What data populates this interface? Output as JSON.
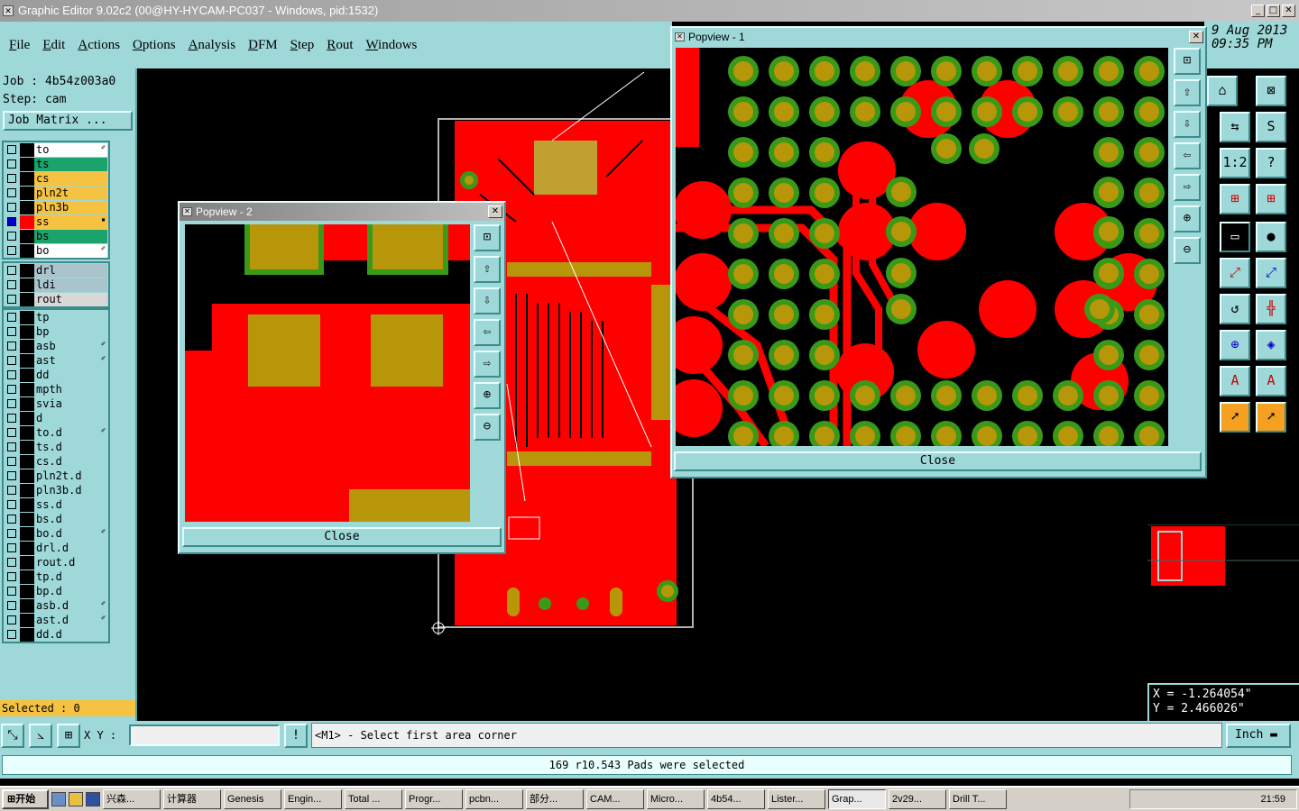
{
  "window": {
    "title": "Graphic Editor 9.02c2 (00@HY-HYCAM-PC037 - Windows, pid:1532)"
  },
  "menu": [
    "File",
    "Edit",
    "Actions",
    "Options",
    "Analysis",
    "DFM",
    "Step",
    "Rout",
    "Windows"
  ],
  "datetime": {
    "date": "9 Aug 2013",
    "time": "09:35 PM"
  },
  "job": {
    "job_line": "Job : 4b54z003a0",
    "step_line": "Step: cam",
    "matrix_button": "Job Matrix ..."
  },
  "layers_board": [
    {
      "name": "to",
      "color": "#ffffff",
      "mark": "✐"
    },
    {
      "name": "ts",
      "color": "#1aa36b",
      "mark": ""
    },
    {
      "name": "cs",
      "color": "#f5c242",
      "mark": ""
    },
    {
      "name": "pln2t",
      "color": "#f5c242",
      "mark": ""
    },
    {
      "name": "pln3b",
      "color": "#f5c242",
      "mark": ""
    },
    {
      "name": "ss",
      "color": "#f5c242",
      "mark": "▪"
    },
    {
      "name": "bs",
      "color": "#1aa36b",
      "mark": ""
    },
    {
      "name": "bo",
      "color": "#ffffff",
      "mark": "✐"
    }
  ],
  "layers_drill": [
    {
      "name": "drl",
      "color": "#a9c4cc",
      "mark": ""
    },
    {
      "name": "ldi",
      "color": "#a9c4cc",
      "mark": ""
    },
    {
      "name": "rout",
      "color": "#d8d8d8",
      "mark": ""
    }
  ],
  "layers_misc": [
    {
      "name": "tp",
      "mark": ""
    },
    {
      "name": "bp",
      "mark": ""
    },
    {
      "name": "asb",
      "mark": "✐"
    },
    {
      "name": "ast",
      "mark": "✐"
    },
    {
      "name": "dd",
      "mark": ""
    },
    {
      "name": "mpth",
      "mark": ""
    },
    {
      "name": "svia",
      "mark": ""
    },
    {
      "name": "d",
      "mark": ""
    },
    {
      "name": "to.d",
      "mark": "✐"
    },
    {
      "name": "ts.d",
      "mark": ""
    },
    {
      "name": "cs.d",
      "mark": ""
    },
    {
      "name": "pln2t.d",
      "mark": ""
    },
    {
      "name": "pln3b.d",
      "mark": ""
    },
    {
      "name": "ss.d",
      "mark": ""
    },
    {
      "name": "bs.d",
      "mark": ""
    },
    {
      "name": "bo.d",
      "mark": "✐"
    },
    {
      "name": "drl.d",
      "mark": ""
    },
    {
      "name": "rout.d",
      "mark": ""
    },
    {
      "name": "tp.d",
      "mark": ""
    },
    {
      "name": "bp.d",
      "mark": ""
    },
    {
      "name": "asb.d",
      "mark": "✐"
    },
    {
      "name": "ast.d",
      "mark": "✐"
    },
    {
      "name": "dd.d",
      "mark": ""
    }
  ],
  "selected": "Selected : 0",
  "popview1": {
    "title": "Popview - 1",
    "close": "Close"
  },
  "popview2": {
    "title": "Popview - 2",
    "close": "Close"
  },
  "coords": {
    "x": "X = -1.264054\"",
    "y": "Y = 2.466026\""
  },
  "bottom": {
    "xy_label": "X Y :",
    "prompt": "<M1> - Select first area corner",
    "unit": "Inch"
  },
  "status": "169 r10.543 Pads were selected",
  "taskbar": {
    "start": "开始",
    "tasks": [
      "兴森...",
      "计算器",
      "Genesis",
      "Engin...",
      "Total ...",
      "Progr...",
      "pcbn...",
      "部分...",
      "CAM...",
      "Micro...",
      "4b54...",
      "Lister...",
      "Grap...",
      "2v29...",
      "Drill T..."
    ],
    "clock": "21:59"
  },
  "colors": {
    "copper": "#ff0000",
    "pad": "#b8960a",
    "via_ring": "#3a9a18",
    "panel": "#9ed8d8",
    "outline": "#ffffff"
  }
}
